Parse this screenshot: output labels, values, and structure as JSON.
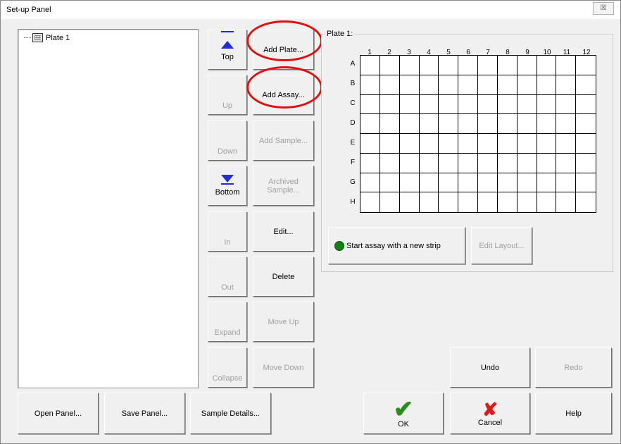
{
  "window": {
    "title": "Set-up Panel",
    "close_glyph": "☒"
  },
  "tree": {
    "items": [
      {
        "label": "Plate 1",
        "icon": "plate-icon"
      }
    ]
  },
  "nav_buttons": {
    "top": "Top",
    "up": "Up",
    "down": "Down",
    "bottom": "Bottom",
    "in": "In",
    "out": "Out",
    "expand": "Expand",
    "collapse": "Collapse"
  },
  "action_buttons": {
    "add_plate": "Add Plate...",
    "add_assay": "Add Assay...",
    "add_sample": "Add Sample...",
    "archived_sample_1": "Archived",
    "archived_sample_2": "Sample...",
    "edit": "Edit...",
    "delete": "Delete",
    "move_up": "Move Up",
    "move_down": "Move Down"
  },
  "plate": {
    "group_label": "Plate 1:",
    "columns": [
      "1",
      "2",
      "3",
      "4",
      "5",
      "6",
      "7",
      "8",
      "9",
      "10",
      "11",
      "12"
    ],
    "rows": [
      "A",
      "B",
      "C",
      "D",
      "E",
      "F",
      "G",
      "H"
    ],
    "start_assay_label": "Start assay with a new strip",
    "edit_layout_label": "Edit Layout..."
  },
  "bottom_buttons": {
    "open_panel": "Open Panel...",
    "save_panel": "Save Panel...",
    "sample_details": "Sample Details...",
    "ok": "OK",
    "cancel": "Cancel",
    "help": "Help",
    "undo": "Undo",
    "redo": "Redo"
  },
  "colors": {
    "highlight_circle": "#e01010",
    "arrow_blue": "#1f2ed6",
    "status_green": "#128012"
  }
}
